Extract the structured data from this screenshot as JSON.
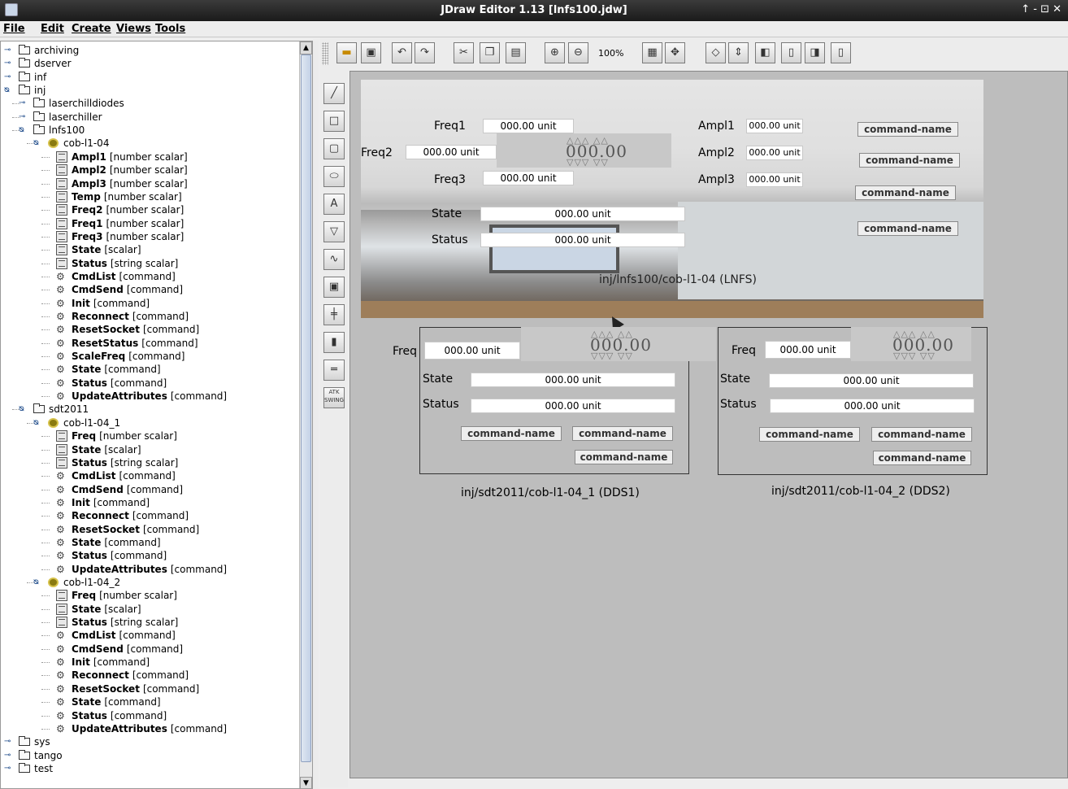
{
  "window": {
    "title": "JDraw Editor 1.13 [lnfs100.jdw]",
    "controls": "↑ - ⊡ ✕"
  },
  "menubar": [
    {
      "label": "File"
    },
    {
      "label": "Edit"
    },
    {
      "label": "Create"
    },
    {
      "label": "Views"
    },
    {
      "label": "Tools"
    }
  ],
  "toolbar": {
    "zoom": "100%"
  },
  "tree": [
    {
      "label": "archiving",
      "kind": "folder",
      "toggle": "o-"
    },
    {
      "label": "dserver",
      "kind": "folder",
      "toggle": "o-"
    },
    {
      "label": "inf",
      "kind": "folder",
      "toggle": "o-"
    },
    {
      "label": "inj",
      "kind": "folder",
      "toggle": "o"
    },
    {
      "label": "laserchilldiodes",
      "kind": "folder",
      "toggle": "o-"
    },
    {
      "label": "laserchiller",
      "kind": "folder",
      "toggle": "o-"
    },
    {
      "label": "lnfs100",
      "kind": "folder",
      "toggle": "o"
    },
    {
      "label": "cob-l1-04",
      "kind": "device",
      "toggle": "o"
    },
    {
      "name": "Ampl1",
      "type": "[number scalar]",
      "kind": "attr"
    },
    {
      "name": "Ampl2",
      "type": "[number scalar]",
      "kind": "attr"
    },
    {
      "name": "Ampl3",
      "type": "[number scalar]",
      "kind": "attr"
    },
    {
      "name": "Temp",
      "type": "[number scalar]",
      "kind": "attr"
    },
    {
      "name": "Freq2",
      "type": "[number scalar]",
      "kind": "attr"
    },
    {
      "name": "Freq1",
      "type": "[number scalar]",
      "kind": "attr"
    },
    {
      "name": "Freq3",
      "type": "[number scalar]",
      "kind": "attr"
    },
    {
      "name": "State",
      "type": "[scalar]",
      "kind": "attr"
    },
    {
      "name": "Status",
      "type": "[string scalar]",
      "kind": "attr"
    },
    {
      "name": "CmdList",
      "type": "[command]",
      "kind": "cmd"
    },
    {
      "name": "CmdSend",
      "type": "[command]",
      "kind": "cmd"
    },
    {
      "name": "Init",
      "type": "[command]",
      "kind": "cmd"
    },
    {
      "name": "Reconnect",
      "type": "[command]",
      "kind": "cmd"
    },
    {
      "name": "ResetSocket",
      "type": "[command]",
      "kind": "cmd"
    },
    {
      "name": "ResetStatus",
      "type": "[command]",
      "kind": "cmd"
    },
    {
      "name": "ScaleFreq",
      "type": "[command]",
      "kind": "cmd"
    },
    {
      "name": "State",
      "type": "[command]",
      "kind": "cmd"
    },
    {
      "name": "Status",
      "type": "[command]",
      "kind": "cmd"
    },
    {
      "name": "UpdateAttributes",
      "type": "[command]",
      "kind": "cmd"
    },
    {
      "label": "sdt2011",
      "kind": "folder",
      "toggle": "o"
    },
    {
      "label": "cob-l1-04_1",
      "kind": "device",
      "toggle": "o"
    },
    {
      "name": "Freq",
      "type": "[number scalar]",
      "kind": "attr"
    },
    {
      "name": "State",
      "type": "[scalar]",
      "kind": "attr"
    },
    {
      "name": "Status",
      "type": "[string scalar]",
      "kind": "attr"
    },
    {
      "name": "CmdList",
      "type": "[command]",
      "kind": "cmd"
    },
    {
      "name": "CmdSend",
      "type": "[command]",
      "kind": "cmd"
    },
    {
      "name": "Init",
      "type": "[command]",
      "kind": "cmd"
    },
    {
      "name": "Reconnect",
      "type": "[command]",
      "kind": "cmd"
    },
    {
      "name": "ResetSocket",
      "type": "[command]",
      "kind": "cmd"
    },
    {
      "name": "State",
      "type": "[command]",
      "kind": "cmd"
    },
    {
      "name": "Status",
      "type": "[command]",
      "kind": "cmd"
    },
    {
      "name": "UpdateAttributes",
      "type": "[command]",
      "kind": "cmd"
    },
    {
      "label": "cob-l1-04_2",
      "kind": "device",
      "toggle": "o"
    },
    {
      "name": "Freq",
      "type": "[number scalar]",
      "kind": "attr"
    },
    {
      "name": "State",
      "type": "[scalar]",
      "kind": "attr"
    },
    {
      "name": "Status",
      "type": "[string scalar]",
      "kind": "attr"
    },
    {
      "name": "CmdList",
      "type": "[command]",
      "kind": "cmd"
    },
    {
      "name": "CmdSend",
      "type": "[command]",
      "kind": "cmd"
    },
    {
      "name": "Init",
      "type": "[command]",
      "kind": "cmd"
    },
    {
      "name": "Reconnect",
      "type": "[command]",
      "kind": "cmd"
    },
    {
      "name": "ResetSocket",
      "type": "[command]",
      "kind": "cmd"
    },
    {
      "name": "State",
      "type": "[command]",
      "kind": "cmd"
    },
    {
      "name": "Status",
      "type": "[command]",
      "kind": "cmd"
    },
    {
      "name": "UpdateAttributes",
      "type": "[command]",
      "kind": "cmd"
    },
    {
      "label": "sys",
      "kind": "folder",
      "toggle": "o-"
    },
    {
      "label": "tango",
      "kind": "folder",
      "toggle": "o-"
    },
    {
      "label": "test",
      "kind": "folder",
      "toggle": "o-"
    }
  ],
  "panel_lnfs": {
    "freq1_label": "Freq1",
    "freq1_value": "000.00 unit",
    "freq2_label": "Freq2",
    "freq2_value": "000.00 unit",
    "freq3_label": "Freq3",
    "freq3_value": "000.00 unit",
    "spinner_value": "000.00",
    "ampl1_label": "Ampl1",
    "ampl1_value": "000.00 unit",
    "ampl2_label": "Ampl2",
    "ampl2_value": "000.00 unit",
    "ampl3_label": "Ampl3",
    "ampl3_value": "000.00 unit",
    "state_label": "State",
    "state_value": "000.00 unit",
    "status_label": "Status",
    "status_value": "000.00 unit",
    "cmd1": "command-name",
    "cmd2": "command-name",
    "cmd3": "command-name",
    "cmd4": "command-name",
    "device_label": "inj/lnfs100/cob-l1-04 (LNFS)"
  },
  "panel_dds1": {
    "freq_label": "Freq",
    "freq_value": "000.00 unit",
    "spinner_value": "000.00",
    "state_label": "State",
    "state_value": "000.00 unit",
    "status_label": "Status",
    "status_value": "000.00 unit",
    "cmd1": "command-name",
    "cmd2": "command-name",
    "cmd3": "command-name",
    "device_label": "inj/sdt2011/cob-l1-04_1 (DDS1)"
  },
  "panel_dds2": {
    "freq_label": "Freq",
    "freq_value": "000.00 unit",
    "spinner_value": "000.00",
    "state_label": "State",
    "state_value": "000.00 unit",
    "status_label": "Status",
    "status_value": "000.00 unit",
    "cmd1": "command-name",
    "cmd2": "command-name",
    "cmd3": "command-name",
    "device_label": "inj/sdt2011/cob-l1-04_2 (DDS2)"
  },
  "icons": {
    "toolbar": [
      "open-icon",
      "save-icon",
      "undo-icon",
      "redo-icon",
      "cut-icon",
      "copy-icon",
      "paste-icon",
      "zoom-in-icon",
      "zoom-out-icon",
      "grid-icon",
      "align-icon",
      "hflip-icon",
      "vflip-icon",
      "front-icon",
      "back-icon",
      "group-icon",
      "ungroup-icon"
    ],
    "tools": [
      "line-tool-icon",
      "rectangle-tool-icon",
      "roundrect-tool-icon",
      "ellipse-tool-icon",
      "text-tool-icon",
      "polyline-tool-icon",
      "spline-tool-icon",
      "image-tool-icon",
      "axis-tool-icon",
      "bar-tool-icon",
      "slider-tool-icon",
      "atk-swing-icon"
    ]
  }
}
